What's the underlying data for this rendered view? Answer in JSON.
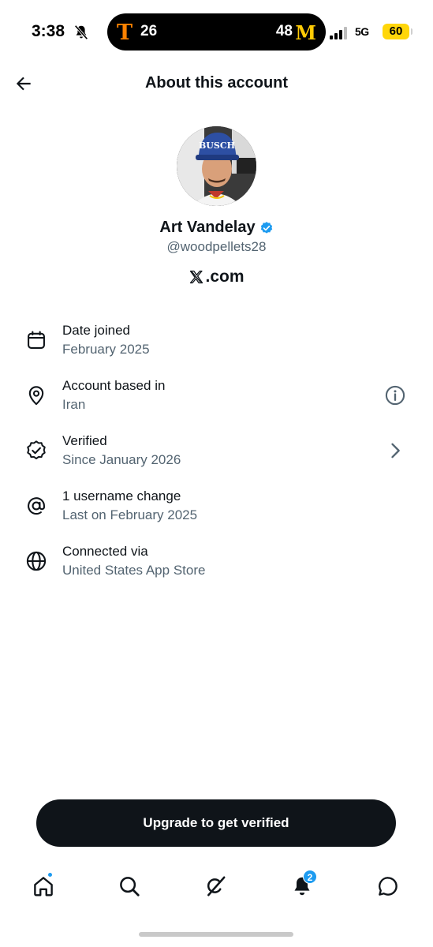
{
  "status_bar": {
    "time": "3:38",
    "team_left_logo": "T",
    "score_left": "26",
    "score_right": "48",
    "team_right_logo": "M",
    "network": "5G",
    "battery": "60"
  },
  "header": {
    "title": "About this account",
    "back_icon": "arrow-left-icon"
  },
  "profile": {
    "display_name": "Art Vandelay",
    "handle": "@woodpellets28",
    "site": ".com",
    "avatar_hat_text": "BUSCH",
    "verified_color": "#1d9bf0"
  },
  "info_items": [
    {
      "icon": "calendar-icon",
      "label": "Date joined",
      "value": "February 2025"
    },
    {
      "icon": "location-pin-icon",
      "label": "Account based in",
      "value": "Iran",
      "action": "info-icon"
    },
    {
      "icon": "verified-outline-icon",
      "label": "Verified",
      "value": "Since January 2026",
      "action": "chevron-right-icon"
    },
    {
      "icon": "at-sign-icon",
      "label": "1 username change",
      "value": "Last on February 2025"
    },
    {
      "icon": "globe-icon",
      "label": "Connected via",
      "value": "United States App Store"
    }
  ],
  "cta": {
    "label": "Upgrade to get verified"
  },
  "tabbar": {
    "items": [
      "home-icon",
      "search-icon",
      "grok-icon",
      "notifications-icon",
      "chat-icon"
    ],
    "notification_count": "2",
    "accent": "#1d9bf0"
  },
  "colors": {
    "primary_text": "#0f1419",
    "secondary_text": "#536471",
    "button_bg": "#0f1419"
  }
}
